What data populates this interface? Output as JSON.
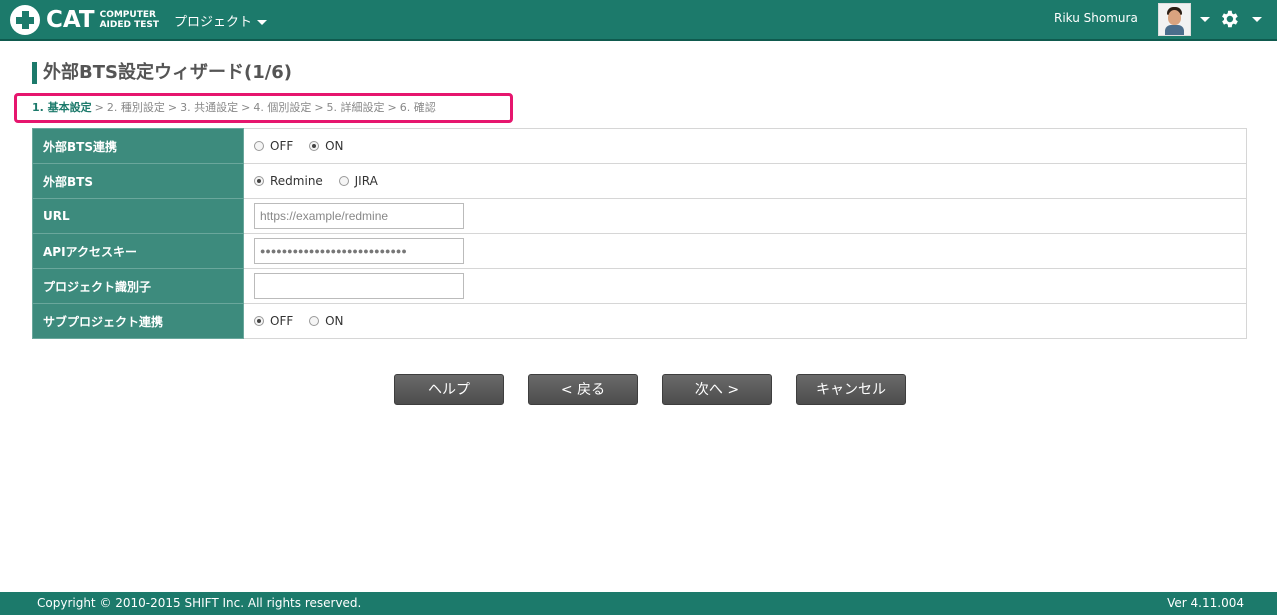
{
  "header": {
    "logo_text": "CAT",
    "logo_sub_line1": "COMPUTER",
    "logo_sub_line2": "AIDED TEST",
    "project_menu": "プロジェクト",
    "user_name": "Riku Shomura"
  },
  "page": {
    "title": "外部BTS設定ウィザード(1/6)"
  },
  "steps": [
    {
      "label": "1. 基本設定",
      "active": true
    },
    {
      "label": "2. 種別設定",
      "active": false
    },
    {
      "label": "3. 共通設定",
      "active": false
    },
    {
      "label": "4. 個別設定",
      "active": false
    },
    {
      "label": "5. 詳細設定",
      "active": false
    },
    {
      "label": "6. 確認",
      "active": false
    }
  ],
  "form": {
    "bts_link": {
      "label": "外部BTS連携",
      "options": [
        "OFF",
        "ON"
      ],
      "selected": "ON"
    },
    "bts_type": {
      "label": "外部BTS",
      "options": [
        "Redmine",
        "JIRA"
      ],
      "selected": "Redmine"
    },
    "url": {
      "label": "URL",
      "value": "",
      "placeholder": "https://example/redmine"
    },
    "api_key": {
      "label": "APIアクセスキー",
      "value": "●●●●●●●●●●●●●●●●●●●●●●●●●●●"
    },
    "project_id": {
      "label": "プロジェクト識別子",
      "value": ""
    },
    "subproject": {
      "label": "サブプロジェクト連携",
      "options": [
        "OFF",
        "ON"
      ],
      "selected": "OFF"
    }
  },
  "buttons": {
    "help": "ヘルプ",
    "back": "< 戻る",
    "next": "次へ >",
    "cancel": "キャンセル"
  },
  "footer": {
    "copyright": "Copyright © 2010-2015 SHIFT Inc. All rights reserved.",
    "version": "Ver 4.11.004"
  },
  "colors": {
    "brand": "#1c7a6b",
    "label_bg": "#3d8b7d",
    "highlight": "#e6166e"
  }
}
